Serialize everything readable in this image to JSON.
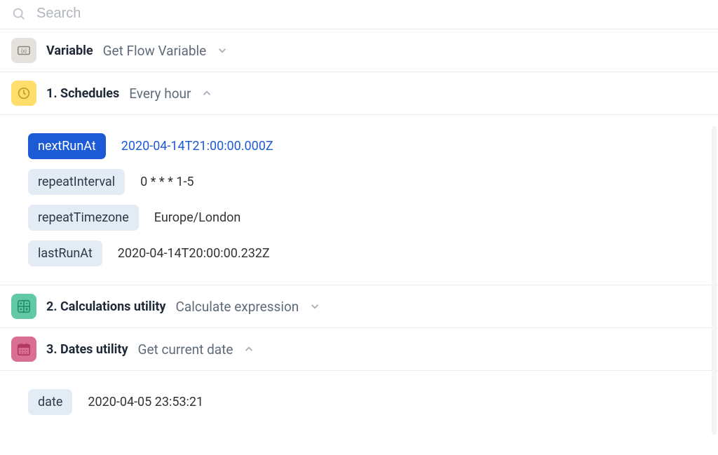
{
  "search": {
    "placeholder": "Search"
  },
  "steps": {
    "variable": {
      "title": "Variable",
      "subtitle": "Get Flow Variable"
    },
    "schedules": {
      "title": "1. Schedules",
      "subtitle": "Every hour"
    },
    "calc": {
      "title": "2. Calculations utility",
      "subtitle": "Calculate expression"
    },
    "dates": {
      "title": "3. Dates utility",
      "subtitle": "Get current date"
    }
  },
  "schedule_details": [
    {
      "key": "nextRunAt",
      "value": "2020-04-14T21:00:00.000Z",
      "highlight": true,
      "link": true
    },
    {
      "key": "repeatInterval",
      "value": "0 * * * 1-5"
    },
    {
      "key": "repeatTimezone",
      "value": "Europe/London"
    },
    {
      "key": "lastRunAt",
      "value": "2020-04-14T20:00:00.232Z"
    }
  ],
  "date_details": [
    {
      "key": "date",
      "value": "2020-04-05 23:53:21"
    }
  ]
}
